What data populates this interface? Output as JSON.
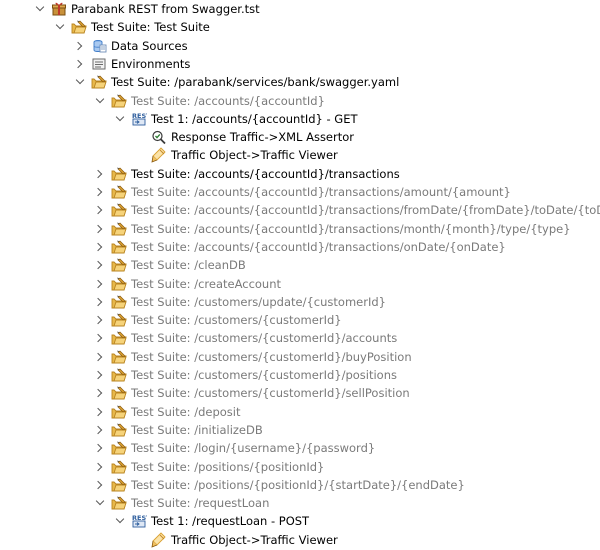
{
  "window_title": "Parabank REST from Swagger.tst",
  "tree": [
    {
      "label": "Parabank REST from Swagger.tst",
      "level": 0,
      "twisty": "expanded",
      "icon": "test-file-icon",
      "gray": false
    },
    {
      "label": "Test Suite: Test Suite",
      "level": 1,
      "twisty": "expanded",
      "icon": "test-suite-icon",
      "gray": false
    },
    {
      "label": "Data Sources",
      "level": 2,
      "twisty": "collapsed",
      "icon": "data-sources-icon",
      "gray": false
    },
    {
      "label": "Environments",
      "level": 2,
      "twisty": "collapsed",
      "icon": "environments-icon",
      "gray": false
    },
    {
      "label": "Test Suite: /parabank/services/bank/swagger.yaml",
      "level": 2,
      "twisty": "expanded",
      "icon": "test-suite-icon",
      "gray": false
    },
    {
      "label": "Test Suite: /accounts/{accountId}",
      "level": 3,
      "twisty": "expanded",
      "icon": "test-suite-icon",
      "gray": true
    },
    {
      "label": "Test 1: /accounts/{accountId} - GET",
      "level": 4,
      "twisty": "expanded",
      "icon": "rest-icon",
      "gray": false
    },
    {
      "label": "Response Traffic->XML Assertor",
      "level": 5,
      "twisty": "none",
      "icon": "xml-assertor-icon",
      "gray": false
    },
    {
      "label": "Traffic Object->Traffic Viewer",
      "level": 5,
      "twisty": "none",
      "icon": "traffic-viewer-icon",
      "gray": false
    },
    {
      "label": "Test Suite: /accounts/{accountId}/transactions",
      "level": 3,
      "twisty": "collapsed",
      "icon": "test-suite-icon",
      "gray": false
    },
    {
      "label": "Test Suite: /accounts/{accountId}/transactions/amount/{amount}",
      "level": 3,
      "twisty": "collapsed",
      "icon": "test-suite-icon",
      "gray": true
    },
    {
      "label": "Test Suite: /accounts/{accountId}/transactions/fromDate/{fromDate}/toDate/{toDate}",
      "level": 3,
      "twisty": "collapsed",
      "icon": "test-suite-icon",
      "gray": true
    },
    {
      "label": "Test Suite: /accounts/{accountId}/transactions/month/{month}/type/{type}",
      "level": 3,
      "twisty": "collapsed",
      "icon": "test-suite-icon",
      "gray": true
    },
    {
      "label": "Test Suite: /accounts/{accountId}/transactions/onDate/{onDate}",
      "level": 3,
      "twisty": "collapsed",
      "icon": "test-suite-icon",
      "gray": true
    },
    {
      "label": "Test Suite: /cleanDB",
      "level": 3,
      "twisty": "collapsed",
      "icon": "test-suite-icon",
      "gray": true
    },
    {
      "label": "Test Suite: /createAccount",
      "level": 3,
      "twisty": "collapsed",
      "icon": "test-suite-icon",
      "gray": true
    },
    {
      "label": "Test Suite: /customers/update/{customerId}",
      "level": 3,
      "twisty": "collapsed",
      "icon": "test-suite-icon",
      "gray": true
    },
    {
      "label": "Test Suite: /customers/{customerId}",
      "level": 3,
      "twisty": "collapsed",
      "icon": "test-suite-icon",
      "gray": true
    },
    {
      "label": "Test Suite: /customers/{customerId}/accounts",
      "level": 3,
      "twisty": "collapsed",
      "icon": "test-suite-icon",
      "gray": true
    },
    {
      "label": "Test Suite: /customers/{customerId}/buyPosition",
      "level": 3,
      "twisty": "collapsed",
      "icon": "test-suite-icon",
      "gray": true
    },
    {
      "label": "Test Suite: /customers/{customerId}/positions",
      "level": 3,
      "twisty": "collapsed",
      "icon": "test-suite-icon",
      "gray": true
    },
    {
      "label": "Test Suite: /customers/{customerId}/sellPosition",
      "level": 3,
      "twisty": "collapsed",
      "icon": "test-suite-icon",
      "gray": true
    },
    {
      "label": "Test Suite: /deposit",
      "level": 3,
      "twisty": "collapsed",
      "icon": "test-suite-icon",
      "gray": true
    },
    {
      "label": "Test Suite: /initializeDB",
      "level": 3,
      "twisty": "collapsed",
      "icon": "test-suite-icon",
      "gray": true
    },
    {
      "label": "Test Suite: /login/{username}/{password}",
      "level": 3,
      "twisty": "collapsed",
      "icon": "test-suite-icon",
      "gray": true
    },
    {
      "label": "Test Suite: /positions/{positionId}",
      "level": 3,
      "twisty": "collapsed",
      "icon": "test-suite-icon",
      "gray": true
    },
    {
      "label": "Test Suite: /positions/{positionId}/{startDate}/{endDate}",
      "level": 3,
      "twisty": "collapsed",
      "icon": "test-suite-icon",
      "gray": true
    },
    {
      "label": "Test Suite: /requestLoan",
      "level": 3,
      "twisty": "expanded",
      "icon": "test-suite-icon",
      "gray": true
    },
    {
      "label": "Test 1: /requestLoan - POST",
      "level": 4,
      "twisty": "expanded",
      "icon": "rest-icon",
      "gray": false
    },
    {
      "label": "Traffic Object->Traffic Viewer",
      "level": 5,
      "twisty": "none",
      "icon": "traffic-viewer-icon",
      "gray": false
    }
  ],
  "colors": {
    "text": "#000000",
    "gray_text": "#7a7a7a",
    "suite_folder": "#e8b84a",
    "suite_folder_dark": "#b98420",
    "pencil": "#d9a030",
    "rest_blue": "#2f5f9e",
    "data_source_blue": "#3d7bc8"
  }
}
